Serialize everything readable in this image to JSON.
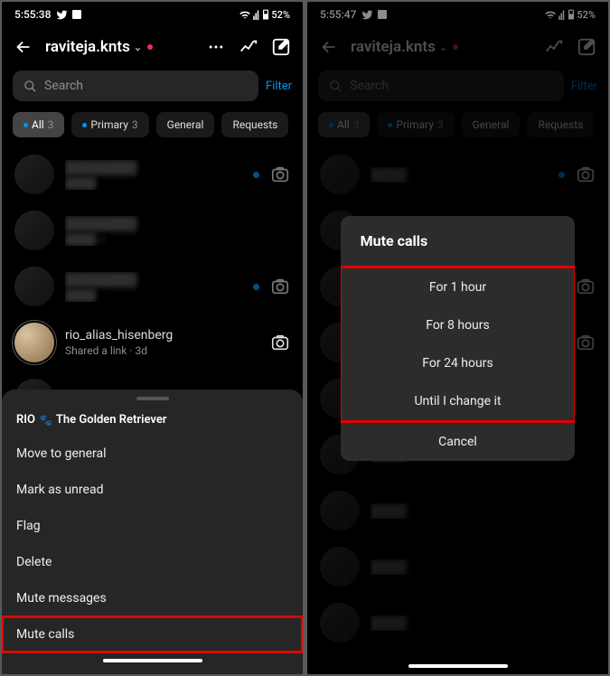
{
  "statusbar": {
    "time_left": "5:55:38",
    "time_right": "5:55:47",
    "battery": "52%"
  },
  "header": {
    "username": "raviteja.knts"
  },
  "search": {
    "placeholder": "Search",
    "filter": "Filter"
  },
  "tabs": {
    "all": {
      "label": "All",
      "count": "3"
    },
    "primary": {
      "label": "Primary",
      "count": "3"
    },
    "general": {
      "label": "General"
    },
    "requests": {
      "label": "Requests"
    }
  },
  "visible_chat": {
    "name": "rio_alias_hisenberg",
    "sub": "Shared a link · 3d"
  },
  "sheet": {
    "title_prefix": "RIO",
    "title_suffix": "The Golden Retriever",
    "items": {
      "move": "Move to general",
      "unread": "Mark as unread",
      "flag": "Flag",
      "delete": "Delete",
      "mute_msgs": "Mute messages",
      "mute_calls": "Mute calls"
    }
  },
  "dialog": {
    "title": "Mute calls",
    "opt1": "For 1 hour",
    "opt8": "For 8 hours",
    "opt24": "For 24 hours",
    "until": "Until I change it",
    "cancel": "Cancel"
  }
}
